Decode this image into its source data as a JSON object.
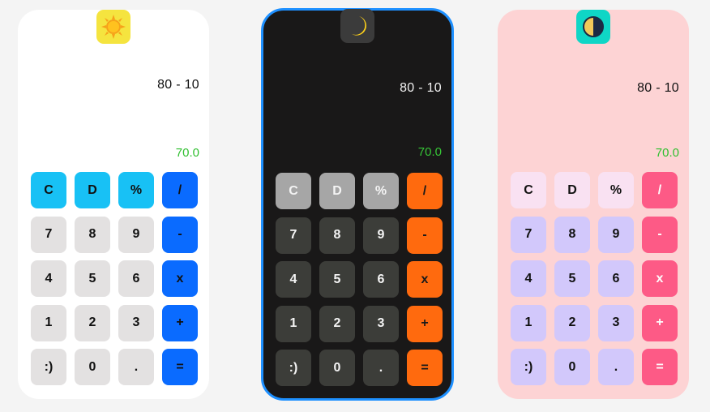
{
  "calculators": [
    {
      "theme": "light",
      "theme_icon": "sun-icon",
      "expression": "80 - 10",
      "result": "70.0",
      "keys": [
        "C",
        "D",
        "%",
        "/",
        "7",
        "8",
        "9",
        "-",
        "4",
        "5",
        "6",
        "x",
        "1",
        "2",
        "3",
        "+",
        ":)",
        "0",
        ".",
        "="
      ]
    },
    {
      "theme": "dark",
      "theme_icon": "moon-icon",
      "expression": "80 - 10",
      "result": "70.0",
      "keys": [
        "C",
        "D",
        "%",
        "/",
        "7",
        "8",
        "9",
        "-",
        "4",
        "5",
        "6",
        "x",
        "1",
        "2",
        "3",
        "+",
        ":)",
        "0",
        ".",
        "="
      ]
    },
    {
      "theme": "pink",
      "theme_icon": "half-moon-icon",
      "expression": "80 - 10",
      "result": "70.0",
      "keys": [
        "C",
        "D",
        "%",
        "/",
        "7",
        "8",
        "9",
        "-",
        "4",
        "5",
        "6",
        "x",
        "1",
        "2",
        "3",
        "+",
        ":)",
        "0",
        ".",
        "="
      ]
    }
  ],
  "colors": {
    "light": {
      "fn": "#18c1f5",
      "num": "#e3e1e1",
      "op": "#0a6bff",
      "bg": "#ffffff"
    },
    "dark": {
      "fn": "#a6a6a6",
      "num": "#3c3d39",
      "op": "#ff6a0e",
      "bg": "#191818",
      "border": "#1e90ff"
    },
    "pink": {
      "fn": "#f9e1f2",
      "num": "#d2c8fb",
      "op": "#fd5a86",
      "bg": "#fdd3d4"
    },
    "result": "#2fbf2f"
  }
}
